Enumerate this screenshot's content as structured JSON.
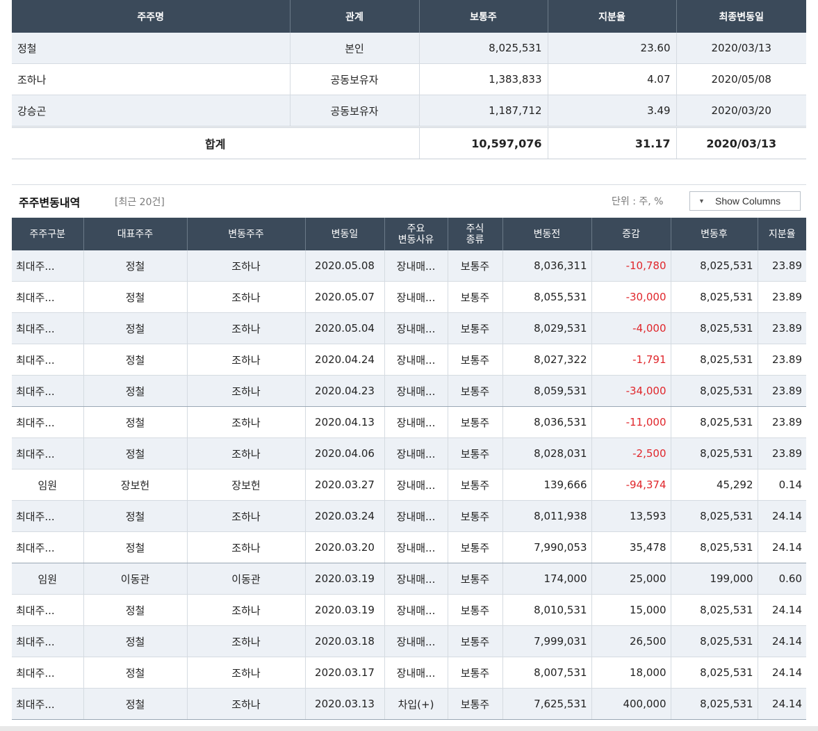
{
  "top_table": {
    "headers": [
      "주주명",
      "관계",
      "보통주",
      "지분율",
      "최종변동일"
    ],
    "rows": [
      {
        "name": "정철",
        "relation": "본인",
        "shares": "8,025,531",
        "ratio": "23.60",
        "date": "2020/03/13"
      },
      {
        "name": "조하나",
        "relation": "공동보유자",
        "shares": "1,383,833",
        "ratio": "4.07",
        "date": "2020/05/08"
      },
      {
        "name": "강승곤",
        "relation": "공동보유자",
        "shares": "1,187,712",
        "ratio": "3.49",
        "date": "2020/03/20"
      }
    ],
    "total": {
      "label": "합계",
      "shares": "10,597,076",
      "ratio": "31.17",
      "date": "2020/03/13"
    }
  },
  "section": {
    "title": "주주변동내역",
    "subtitle": "[최근 20건]",
    "unit": "단위 : 주, %",
    "show_columns": "Show Columns"
  },
  "main_table": {
    "headers": [
      "주주구분",
      "대표주주",
      "변동주주",
      "변동일",
      "주요\n변동사유",
      "주식\n종류",
      "변동전",
      "증감",
      "변동후",
      "지분율"
    ],
    "rows": [
      {
        "type": "최대주...",
        "rep": "정철",
        "holder": "조하나",
        "date": "2020.05.08",
        "reason": "장내매...",
        "kind": "보통주",
        "before": "8,036,311",
        "change": "-10,780",
        "after": "8,025,531",
        "ratio": "23.89"
      },
      {
        "type": "최대주...",
        "rep": "정철",
        "holder": "조하나",
        "date": "2020.05.07",
        "reason": "장내매...",
        "kind": "보통주",
        "before": "8,055,531",
        "change": "-30,000",
        "after": "8,025,531",
        "ratio": "23.89"
      },
      {
        "type": "최대주...",
        "rep": "정철",
        "holder": "조하나",
        "date": "2020.05.04",
        "reason": "장내매...",
        "kind": "보통주",
        "before": "8,029,531",
        "change": "-4,000",
        "after": "8,025,531",
        "ratio": "23.89"
      },
      {
        "type": "최대주...",
        "rep": "정철",
        "holder": "조하나",
        "date": "2020.04.24",
        "reason": "장내매...",
        "kind": "보통주",
        "before": "8,027,322",
        "change": "-1,791",
        "after": "8,025,531",
        "ratio": "23.89"
      },
      {
        "type": "최대주...",
        "rep": "정철",
        "holder": "조하나",
        "date": "2020.04.23",
        "reason": "장내매...",
        "kind": "보통주",
        "before": "8,059,531",
        "change": "-34,000",
        "after": "8,025,531",
        "ratio": "23.89"
      },
      {
        "type": "최대주...",
        "rep": "정철",
        "holder": "조하나",
        "date": "2020.04.13",
        "reason": "장내매...",
        "kind": "보통주",
        "before": "8,036,531",
        "change": "-11,000",
        "after": "8,025,531",
        "ratio": "23.89"
      },
      {
        "type": "최대주...",
        "rep": "정철",
        "holder": "조하나",
        "date": "2020.04.06",
        "reason": "장내매...",
        "kind": "보통주",
        "before": "8,028,031",
        "change": "-2,500",
        "after": "8,025,531",
        "ratio": "23.89"
      },
      {
        "type": "임원",
        "rep": "장보헌",
        "holder": "장보헌",
        "date": "2020.03.27",
        "reason": "장내매...",
        "kind": "보통주",
        "before": "139,666",
        "change": "-94,374",
        "after": "45,292",
        "ratio": "0.14"
      },
      {
        "type": "최대주...",
        "rep": "정철",
        "holder": "조하나",
        "date": "2020.03.24",
        "reason": "장내매...",
        "kind": "보통주",
        "before": "8,011,938",
        "change": "13,593",
        "after": "8,025,531",
        "ratio": "24.14"
      },
      {
        "type": "최대주...",
        "rep": "정철",
        "holder": "조하나",
        "date": "2020.03.20",
        "reason": "장내매...",
        "kind": "보통주",
        "before": "7,990,053",
        "change": "35,478",
        "after": "8,025,531",
        "ratio": "24.14"
      },
      {
        "type": "임원",
        "rep": "이동관",
        "holder": "이동관",
        "date": "2020.03.19",
        "reason": "장내매...",
        "kind": "보통주",
        "before": "174,000",
        "change": "25,000",
        "after": "199,000",
        "ratio": "0.60"
      },
      {
        "type": "최대주...",
        "rep": "정철",
        "holder": "조하나",
        "date": "2020.03.19",
        "reason": "장내매...",
        "kind": "보통주",
        "before": "8,010,531",
        "change": "15,000",
        "after": "8,025,531",
        "ratio": "24.14"
      },
      {
        "type": "최대주...",
        "rep": "정철",
        "holder": "조하나",
        "date": "2020.03.18",
        "reason": "장내매...",
        "kind": "보통주",
        "before": "7,999,031",
        "change": "26,500",
        "after": "8,025,531",
        "ratio": "24.14"
      },
      {
        "type": "최대주...",
        "rep": "정철",
        "holder": "조하나",
        "date": "2020.03.17",
        "reason": "장내매...",
        "kind": "보통주",
        "before": "8,007,531",
        "change": "18,000",
        "after": "8,025,531",
        "ratio": "24.14"
      },
      {
        "type": "최대주...",
        "rep": "정철",
        "holder": "조하나",
        "date": "2020.03.13",
        "reason": "차입(+)",
        "kind": "보통주",
        "before": "7,625,531",
        "change": "400,000",
        "after": "8,025,531",
        "ratio": "24.14"
      }
    ]
  },
  "colors": {
    "header_bg": "#3b4a5a",
    "negative": "#e0262b",
    "stripe": "#edf1f6"
  },
  "icons": {
    "show_columns_dropdown": "triangle-down-icon"
  }
}
